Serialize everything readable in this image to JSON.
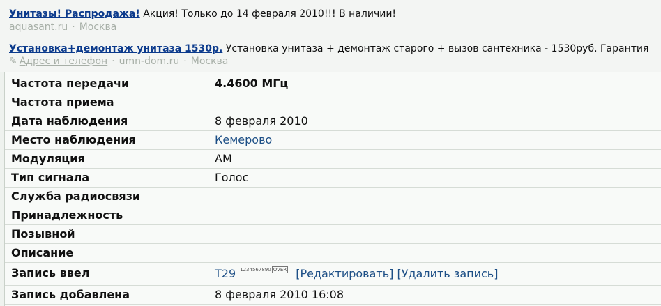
{
  "ads": [
    {
      "title": "Унитазы! Распродажа!",
      "text": "Акция! Только до 14 февраля 2010!!! В наличии!",
      "domain": "aquasant.ru",
      "city": "Москва"
    },
    {
      "title": "Установка+демонтаж унитаза 1530р.",
      "text": "Установка унитаза + демонтаж старого + вызов сантехника - 1530руб. Гарантия",
      "address_link": "Адрес и телефон",
      "domain": "umn-dom.ru",
      "city": "Москва"
    }
  ],
  "meta_separator": "·",
  "record": {
    "rows": [
      {
        "label": "Частота передачи",
        "value": "4.4600 МГц"
      },
      {
        "label": "Частота приема",
        "value": ""
      },
      {
        "label": "Дата наблюдения",
        "value": "8 февраля 2010"
      },
      {
        "label": "Место наблюдения",
        "value": "Кемерово"
      },
      {
        "label": "Модуляция",
        "value": "AM"
      },
      {
        "label": "Тип сигнала",
        "value": "Голос"
      },
      {
        "label": "Служба радиосвязи",
        "value": ""
      },
      {
        "label": "Принадлежность",
        "value": ""
      },
      {
        "label": "Позывной",
        "value": ""
      },
      {
        "label": "Описание",
        "value": ""
      },
      {
        "label": "Запись ввел",
        "value": "T29"
      },
      {
        "label": "Запись добавлена",
        "value": "8 февраля 2010 16:08"
      }
    ],
    "author_badge": {
      "digits": "1234567890",
      "suffix": "OVER"
    },
    "edit_link": "[Редактировать]",
    "delete_link": "[Удалить запись]"
  },
  "colors": {
    "ad_title": "#0b3a8c",
    "link": "#1d4f86",
    "muted": "#a8b0a8"
  }
}
